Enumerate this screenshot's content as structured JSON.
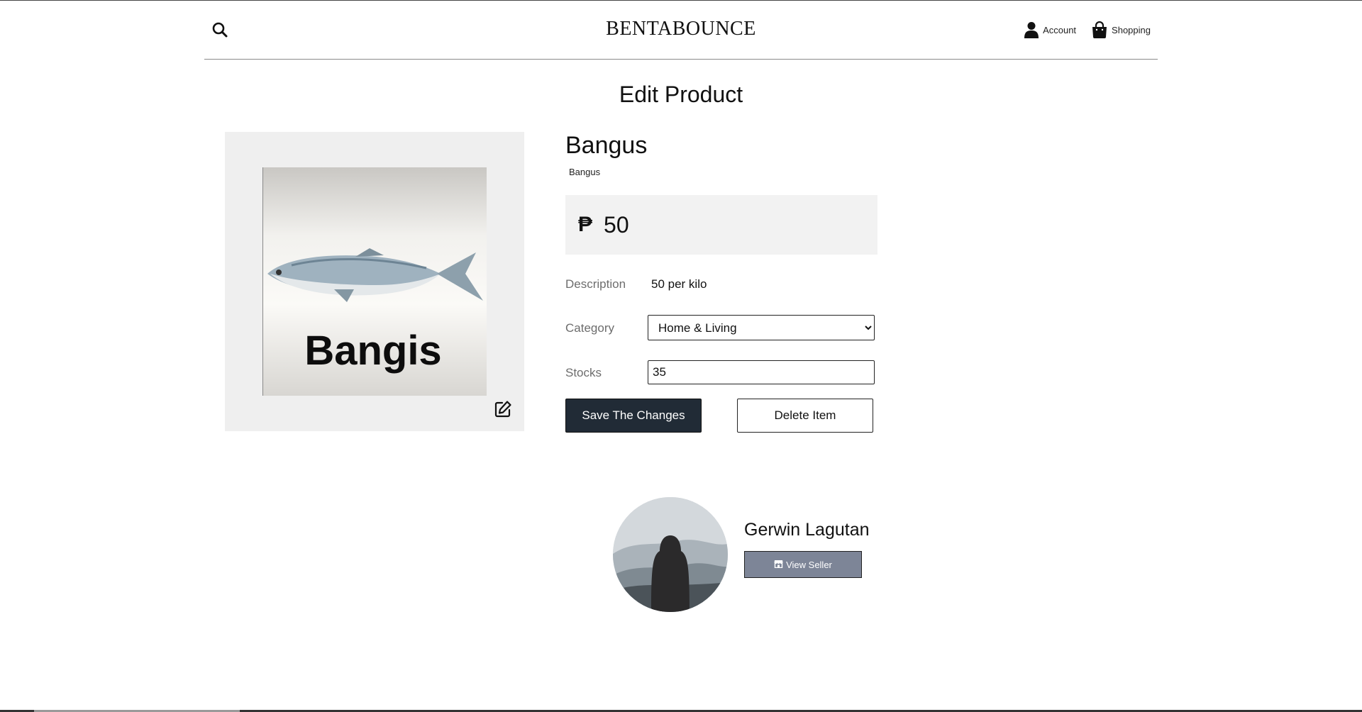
{
  "header": {
    "brand": "BENTABOUNCE",
    "account_label": "Account",
    "shopping_label": "Shopping"
  },
  "page": {
    "title": "Edit Product"
  },
  "product": {
    "image_caption": "Bangis",
    "name": "Bangus",
    "subname": "Bangus",
    "currency_symbol": "₱",
    "price": "50",
    "description_label": "Description",
    "description_value": "50 per kilo",
    "category_label": "Category",
    "category_selected": "Home & Living",
    "stocks_label": "Stocks",
    "stocks_value": "35"
  },
  "actions": {
    "save_label": "Save The Changes",
    "delete_label": "Delete Item"
  },
  "seller": {
    "name": "Gerwin Lagutan",
    "view_label": "View Seller"
  },
  "icons": {
    "search": "search-icon",
    "account": "user-icon",
    "shopping": "shopping-bag-icon",
    "edit": "edit-icon",
    "store": "store-icon"
  },
  "colors": {
    "primary_button": "#212b36",
    "seller_button": "#7d8597",
    "panel_bg": "#efefef",
    "price_bg": "#f2f2f2"
  }
}
